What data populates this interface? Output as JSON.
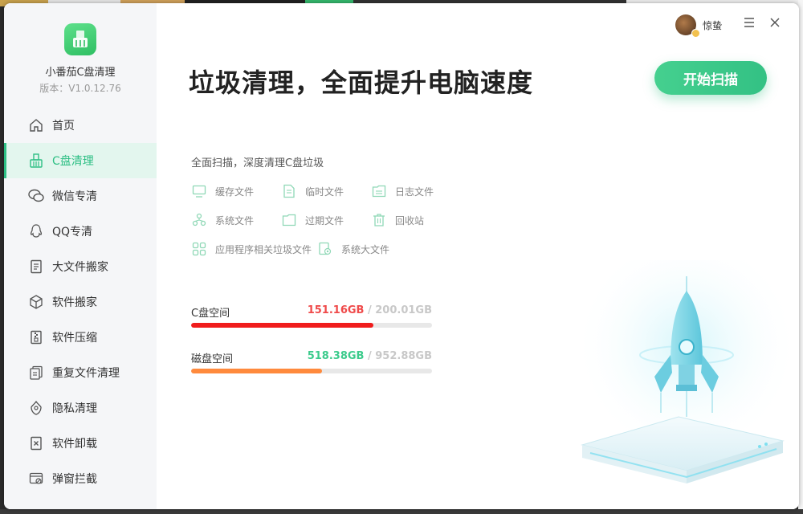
{
  "app": {
    "name": "小番茄C盘清理",
    "version": "版本：V1.0.12.76"
  },
  "sidebar": {
    "items": [
      {
        "label": "首页",
        "icon": "home-icon",
        "active": false
      },
      {
        "label": "C盘清理",
        "icon": "broom-icon",
        "active": true
      },
      {
        "label": "微信专清",
        "icon": "wechat-icon",
        "active": false
      },
      {
        "label": "QQ专清",
        "icon": "qq-icon",
        "active": false
      },
      {
        "label": "大文件搬家",
        "icon": "large-file-icon",
        "active": false
      },
      {
        "label": "软件搬家",
        "icon": "package-icon",
        "active": false
      },
      {
        "label": "软件压缩",
        "icon": "zip-icon",
        "active": false
      },
      {
        "label": "重复文件清理",
        "icon": "duplicate-file-icon",
        "active": false
      },
      {
        "label": "隐私清理",
        "icon": "privacy-shield-icon",
        "active": false
      },
      {
        "label": "软件卸载",
        "icon": "uninstall-icon",
        "active": false
      },
      {
        "label": "弹窗拦截",
        "icon": "popup-block-icon",
        "active": false
      }
    ]
  },
  "header": {
    "username": "惊蛰",
    "title": "垃圾清理，全面提升电脑速度",
    "scan_button": "开始扫描"
  },
  "main": {
    "subtitle": "全面扫描，深度清理C盘垃圾",
    "file_types": [
      {
        "label": "缓存文件",
        "icon": "monitor-icon"
      },
      {
        "label": "临时文件",
        "icon": "temp-file-icon"
      },
      {
        "label": "日志文件",
        "icon": "log-folder-icon"
      },
      {
        "label": "系统文件",
        "icon": "system-file-icon"
      },
      {
        "label": "过期文件",
        "icon": "expired-folder-icon"
      },
      {
        "label": "回收站",
        "icon": "trash-icon"
      },
      {
        "label": "应用程序相关垃圾文件",
        "icon": "apps-grid-icon"
      },
      {
        "label": "系统大文件",
        "icon": "large-system-file-icon"
      }
    ],
    "disks": [
      {
        "label": "C盘空间",
        "used": "151.16GB",
        "total": " / 200.01GB",
        "fraction": 0.756,
        "bar_color": "#f01c1c",
        "used_color": "#ef4a4a"
      },
      {
        "label": "磁盘空间",
        "used": "518.38GB",
        "total": " / 952.88GB",
        "fraction": 0.544,
        "bar_color": "#ff8a3d",
        "used_color": "#3ccb8c"
      }
    ]
  },
  "colors": {
    "accent": "#2dbf84",
    "sidebar_bg": "#f5f6f8"
  }
}
